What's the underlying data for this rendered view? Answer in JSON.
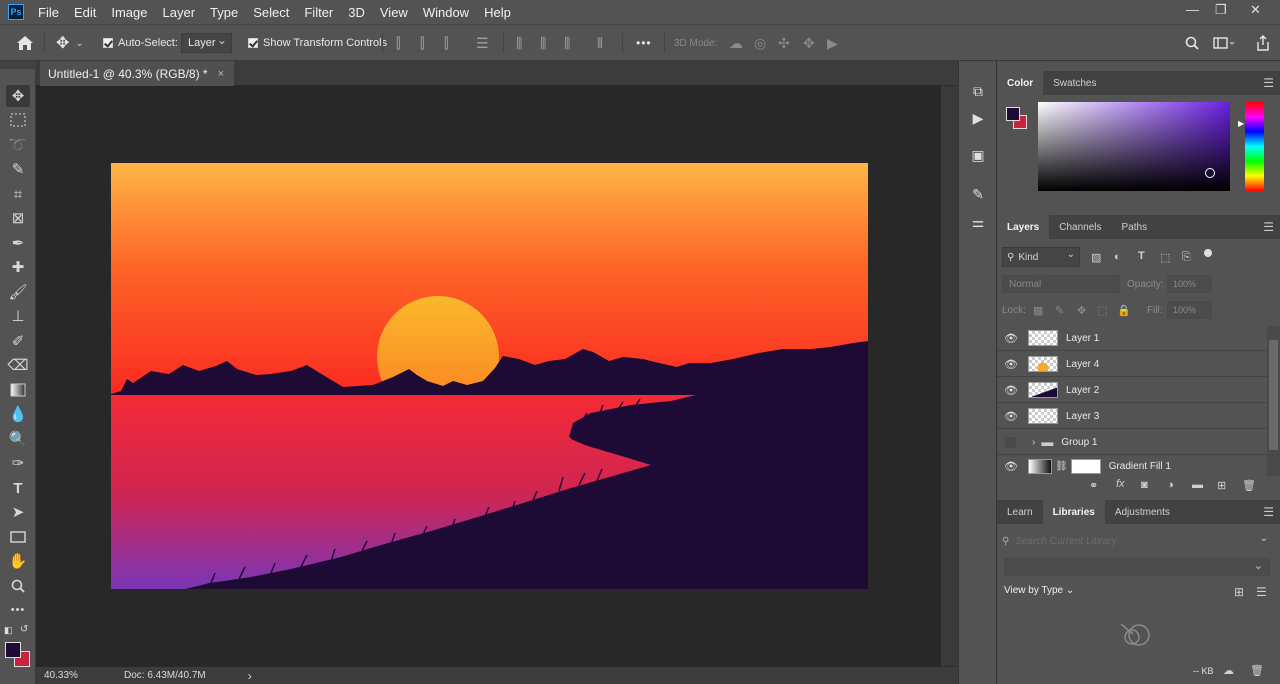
{
  "app": {
    "logo": "Ps"
  },
  "menu": [
    "File",
    "Edit",
    "Image",
    "Layer",
    "Type",
    "Select",
    "Filter",
    "3D",
    "View",
    "Window",
    "Help"
  ],
  "window_controls": {
    "minimize": "—",
    "restore": "❐",
    "close": "✕"
  },
  "options": {
    "auto_select_label": "Auto-Select:",
    "auto_select_value": "Layer",
    "transform_label": "Show Transform Controls",
    "mode_3d_label": "3D Mode:",
    "more": "•••"
  },
  "document": {
    "tab_title": "Untitled-1 @ 40.3% (RGB/8) *",
    "close": "×",
    "zoom": "40.33%",
    "doc_info": "Doc: 6.43M/40.7M",
    "status_arrow": "›"
  },
  "panels": {
    "color_tabs": [
      "Color",
      "Swatches"
    ],
    "layers_tabs": [
      "Layers",
      "Channels",
      "Paths"
    ],
    "kind_label": "Kind",
    "blend_mode": "Normal",
    "opacity_label": "Opacity:",
    "opacity_value": "100%",
    "lock_label": "Lock:",
    "fill_label": "Fill:",
    "fill_value": "100%",
    "layers": [
      {
        "name": "Layer 1"
      },
      {
        "name": "Layer 4"
      },
      {
        "name": "Layer 2"
      },
      {
        "name": "Layer 3"
      },
      {
        "name": "Group 1"
      },
      {
        "name": "Gradient Fill 1"
      }
    ],
    "libraries_tabs": [
      "Learn",
      "Libraries",
      "Adjustments"
    ],
    "search_placeholder": "Search Current Library",
    "view_by_label": "View by Type",
    "kb_label": "-- KB"
  },
  "colors": {
    "foreground": "#1f0b35",
    "background": "#c8243e",
    "accent": "#31a8ff"
  }
}
